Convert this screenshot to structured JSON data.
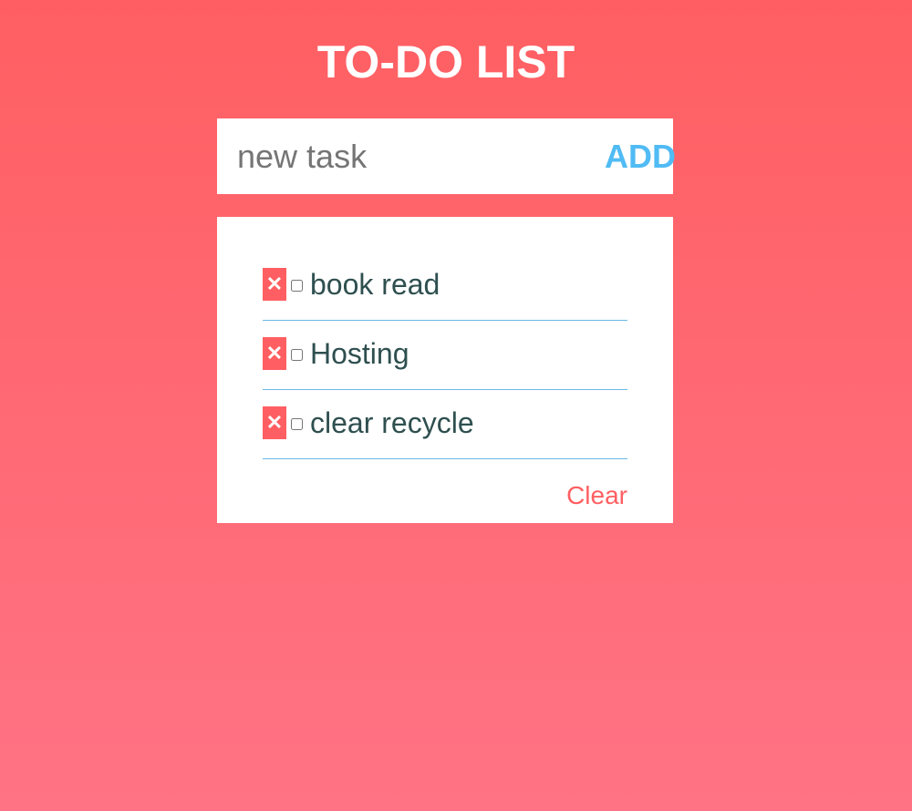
{
  "header": {
    "title": "TO-DO LIST"
  },
  "add_form": {
    "placeholder": "new task",
    "add_label": "ADD"
  },
  "tasks": [
    {
      "delete_icon": "✕",
      "done": false,
      "text": "book read"
    },
    {
      "delete_icon": "✕",
      "done": false,
      "text": "Hosting"
    },
    {
      "delete_icon": "✕",
      "done": false,
      "text": "clear recycle"
    }
  ],
  "footer": {
    "clear_label": "Clear"
  },
  "colors": {
    "accent": "#ff5f62",
    "add_button": "#50bbf4",
    "task_text": "#2f4f4f",
    "divider": "#6ab8e8",
    "background_top": "#ff5f62",
    "background_bottom": "#ff7385"
  }
}
